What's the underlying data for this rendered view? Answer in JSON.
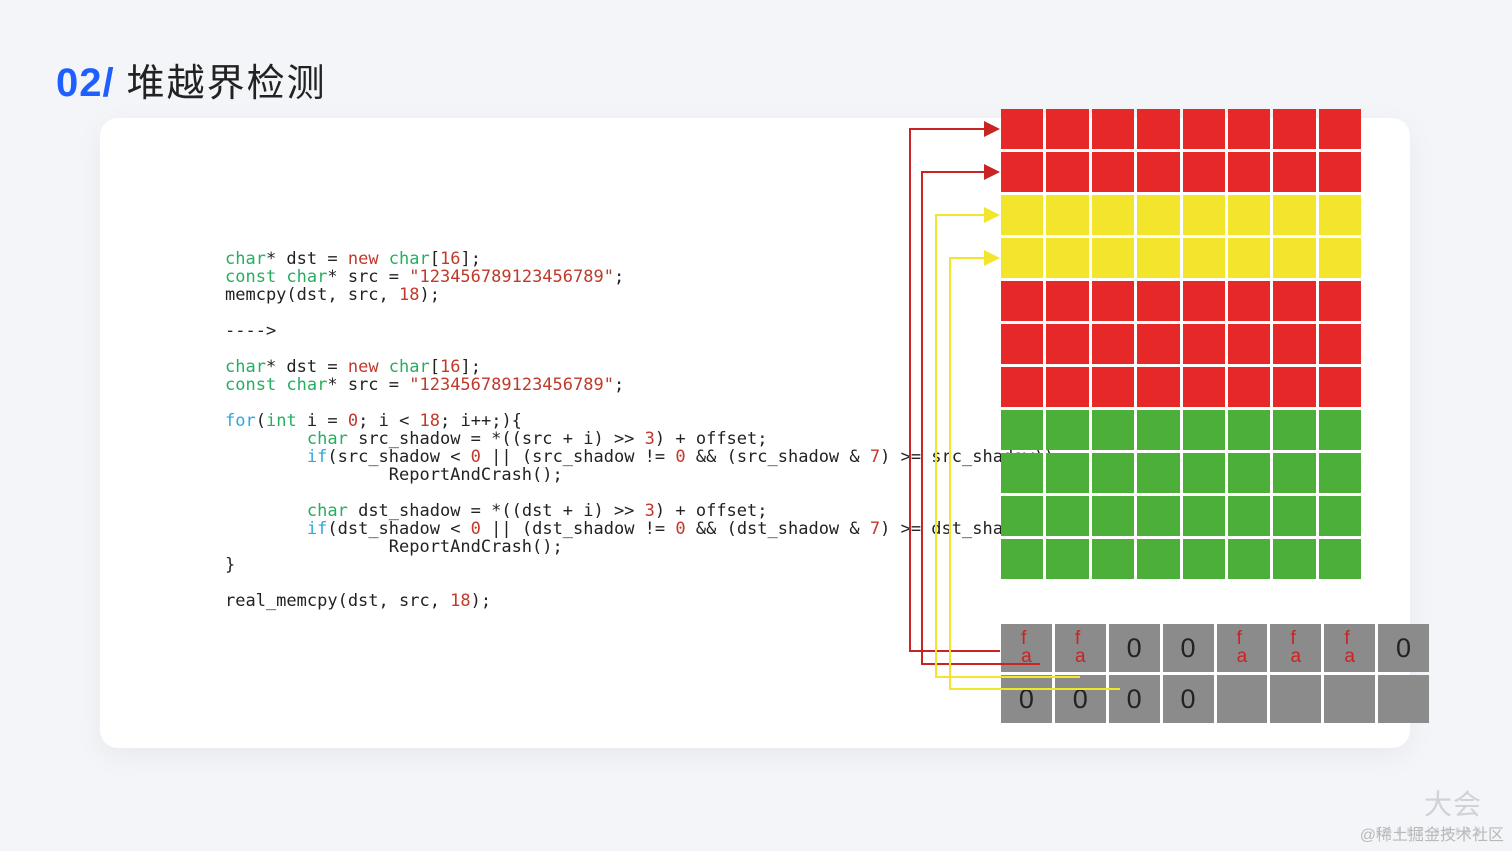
{
  "header": {
    "number": "02/",
    "title": "堆越界检测"
  },
  "code": {
    "l1a": "char",
    "l1b": "* dst = ",
    "l1c": "new",
    "l1d": " char",
    "l1e": "[",
    "l1f": "16",
    "l1g": "];",
    "l2a": "const char",
    "l2b": "* src = ",
    "l2c": "\"123456789123456789\"",
    "l2d": ";",
    "l3a": "memcpy(dst, src, ",
    "l3b": "18",
    "l3c": ");",
    "arrow": "---->",
    "l5a": "char",
    "l5b": "* dst = ",
    "l5c": "new",
    "l5d": " char",
    "l5e": "[",
    "l5f": "16",
    "l5g": "];",
    "l6a": "const char",
    "l6b": "* src = ",
    "l6c": "\"123456789123456789\"",
    "l6d": ";",
    "l8a": "for",
    "l8b": "(",
    "l8c": "int",
    "l8d": " i = ",
    "l8e": "0",
    "l8f": "; i < ",
    "l8g": "18",
    "l8h": "; i++;){",
    "l9a": "        ",
    "l9b": "char",
    "l9c": " src_shadow = *((src + i) >> ",
    "l9d": "3",
    "l9e": ") + offset;",
    "l10a": "        ",
    "l10b": "if",
    "l10c": "(src_shadow < ",
    "l10d": "0",
    "l10e": " || (src_shadow != ",
    "l10f": "0",
    "l10g": " && (src_shadow & ",
    "l10h": "7",
    "l10i": ") >= src_shadow))",
    "l11": "                ReportAndCrash();",
    "l12a": "        ",
    "l12b": "char",
    "l12c": " dst_shadow = *((dst + i) >> ",
    "l12d": "3",
    "l12e": ") + offset;",
    "l13a": "        ",
    "l13b": "if",
    "l13c": "(dst_shadow < ",
    "l13d": "0",
    "l13e": " || (dst_shadow != ",
    "l13f": "0",
    "l13g": " && (dst_shadow & ",
    "l13h": "7",
    "l13i": ") >= dst_shadow))",
    "l14": "                ReportAndCrash();",
    "l15": "}",
    "l17a": "real_memcpy(dst, src, ",
    "l17b": "18",
    "l17c": ");"
  },
  "grid": {
    "rows": [
      [
        "red",
        "red",
        "red",
        "red",
        "red",
        "red",
        "red",
        "red"
      ],
      [
        "red",
        "red",
        "red",
        "red",
        "red",
        "red",
        "red",
        "red"
      ],
      [
        "yellow",
        "yellow",
        "yellow",
        "yellow",
        "yellow",
        "yellow",
        "yellow",
        "yellow"
      ],
      [
        "yellow",
        "yellow",
        "yellow",
        "yellow",
        "yellow",
        "yellow",
        "yellow",
        "yellow"
      ],
      [
        "red",
        "red",
        "red",
        "red",
        "red",
        "red",
        "red",
        "red"
      ],
      [
        "red",
        "red",
        "red",
        "red",
        "red",
        "red",
        "red",
        "red"
      ],
      [
        "red",
        "red",
        "red",
        "red",
        "red",
        "red",
        "red",
        "red"
      ],
      [
        "green",
        "green",
        "green",
        "green",
        "green",
        "green",
        "green",
        "green"
      ],
      [
        "green",
        "green",
        "green",
        "green",
        "green",
        "green",
        "green",
        "green"
      ],
      [
        "green",
        "green",
        "green",
        "green",
        "green",
        "green",
        "green",
        "green"
      ],
      [
        "green",
        "green",
        "green",
        "green",
        "green",
        "green",
        "green",
        "green"
      ]
    ],
    "shadow": [
      [
        "fa",
        "fa",
        "0",
        "0",
        "fa",
        "fa",
        "fa",
        "0"
      ],
      [
        "0",
        "0",
        "0",
        "0",
        "",
        "",
        "",
        ""
      ]
    ]
  },
  "watermark": {
    "text": "@稀土掘金技术社区",
    "logo": "大会",
    "sub": "▮ ▮ ▮ ▮ ▮ | ▮ ▮ ▮ ▮ ▮"
  }
}
